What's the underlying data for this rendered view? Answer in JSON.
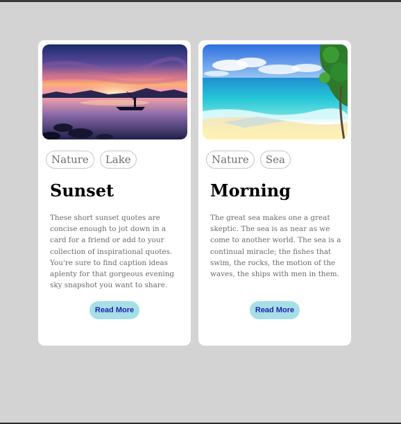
{
  "page": {
    "background": "#d3d3d3"
  },
  "cards": [
    {
      "image": "sunset-lake-fisherman-image",
      "tags": [
        "Nature",
        "Lake"
      ],
      "title": "Sunset",
      "text": "These short sunset quotes are concise enough to jot down in a card for a friend or add to your collection of inspirational quotes. You're sure to find caption ideas aplenty for that gorgeous evening sky snapshot you want to share.",
      "button_label": "Read More"
    },
    {
      "image": "tropical-beach-image",
      "tags": [
        "Nature",
        "Sea"
      ],
      "title": "Morning",
      "text": "The great sea makes one a great skeptic. The sea is as near as we come to another world. The sea is a continual miracle; the fishes that swim, the rocks, the motion of the waves, the ships with men in them.",
      "button_label": "Read More"
    }
  ],
  "colors": {
    "card_background": "#ffffff",
    "button_background": "#a6dfe6",
    "button_text": "#1f1fb0",
    "tag_border": "#c6c6c6",
    "body_text": "#6b6b6b"
  }
}
